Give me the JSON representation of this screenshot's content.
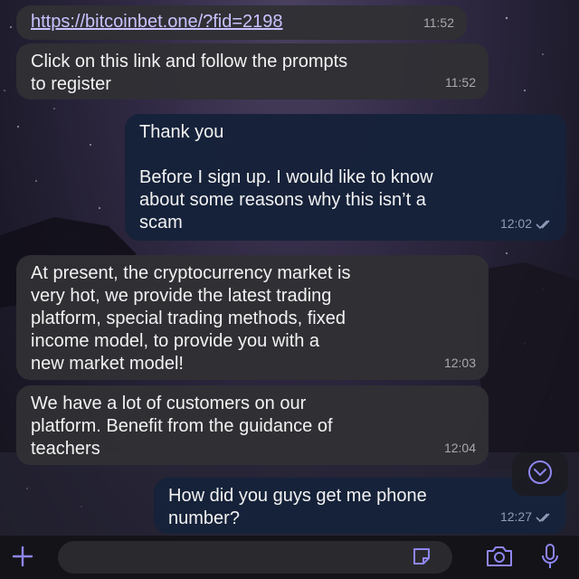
{
  "messages": [
    {
      "direction": "incoming",
      "text": "https://bitcoinbet.one/?fid=2198",
      "time": "11:52",
      "is_link": true
    },
    {
      "direction": "incoming",
      "text": "Click on this link and follow the prompts\nto register",
      "time": "11:52"
    },
    {
      "direction": "outgoing",
      "text": "Thank you\n\nBefore I sign up. I would like to know\nabout some reasons why this isn’t a\nscam",
      "time": "12:02",
      "status": "read"
    },
    {
      "direction": "incoming",
      "text": "At present, the cryptocurrency market is\nvery hot, we provide the latest trading\nplatform, special trading methods, fixed\nincome model, to provide you with a\nnew market model!",
      "time": "12:03"
    },
    {
      "direction": "incoming",
      "text": "We have a lot of customers on our\nplatform. Benefit from the guidance of\nteachers",
      "time": "12:04"
    },
    {
      "direction": "outgoing",
      "text": "How did you guys get me phone\nnumber?",
      "time": "12:27",
      "status": "read"
    }
  ],
  "composer": {
    "placeholder": "",
    "icons": [
      "plus-icon",
      "sticker-icon",
      "camera-icon",
      "microphone-icon"
    ]
  },
  "scroll_down_icon": "chevron-down-circle-icon",
  "colors": {
    "incoming_bubble": "#303034",
    "outgoing_bubble": "#16223a",
    "accent": "#8f86f0",
    "link": "#c9c2ff"
  }
}
